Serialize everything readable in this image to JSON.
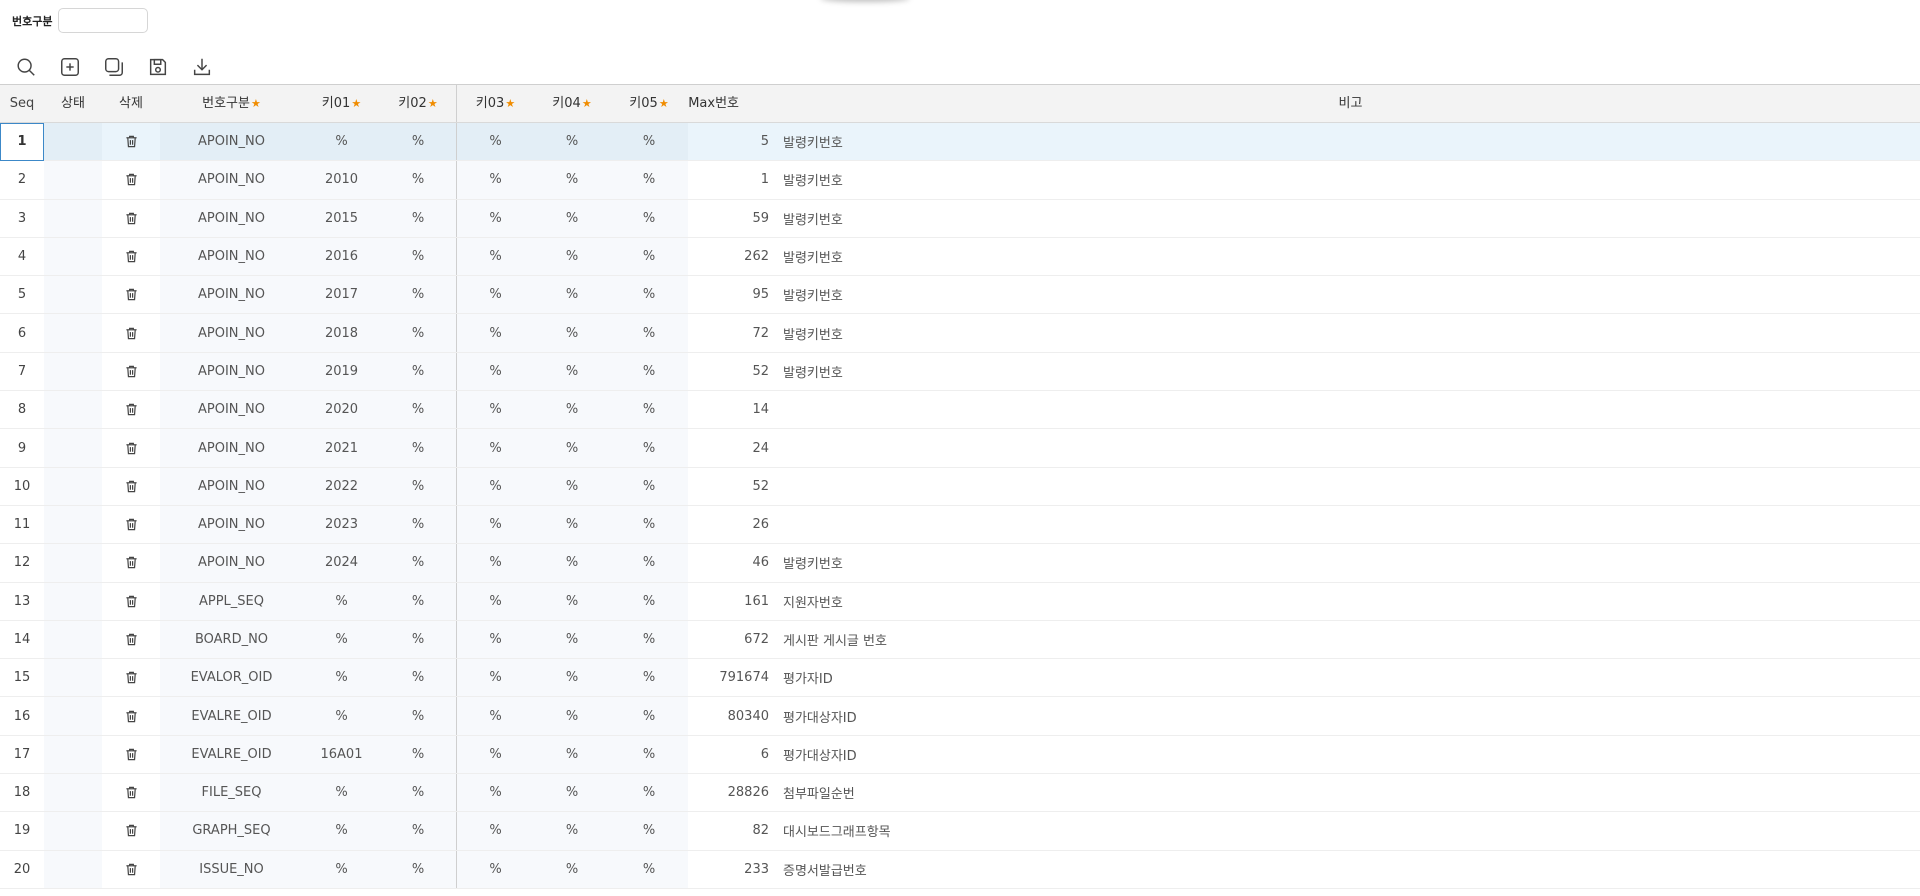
{
  "filter": {
    "label": "번호구분",
    "value": ""
  },
  "toolbar": {
    "buttons": [
      {
        "icon": "search-icon"
      },
      {
        "icon": "add-icon"
      },
      {
        "icon": "copy-icon"
      },
      {
        "icon": "save-icon"
      },
      {
        "icon": "download-icon"
      }
    ]
  },
  "columns": {
    "seq": "Seq",
    "state": "상태",
    "delete": "삭제",
    "number_type": "번호구분",
    "key01": "키01",
    "key02": "키02",
    "key03": "키03",
    "key04": "키04",
    "key05": "키05",
    "max_number": "Max번호",
    "note": "비고",
    "required_marker": "★",
    "required_marker_color": "#f08c00"
  },
  "rows": [
    {
      "seq": "1",
      "number_type": "APOIN_NO",
      "key01": "%",
      "key02": "%",
      "key03": "%",
      "key04": "%",
      "key05": "%",
      "max_number": "5",
      "note": "발령키번호"
    },
    {
      "seq": "2",
      "number_type": "APOIN_NO",
      "key01": "2010",
      "key02": "%",
      "key03": "%",
      "key04": "%",
      "key05": "%",
      "max_number": "1",
      "note": "발령키번호"
    },
    {
      "seq": "3",
      "number_type": "APOIN_NO",
      "key01": "2015",
      "key02": "%",
      "key03": "%",
      "key04": "%",
      "key05": "%",
      "max_number": "59",
      "note": "발령키번호"
    },
    {
      "seq": "4",
      "number_type": "APOIN_NO",
      "key01": "2016",
      "key02": "%",
      "key03": "%",
      "key04": "%",
      "key05": "%",
      "max_number": "262",
      "note": "발령키번호"
    },
    {
      "seq": "5",
      "number_type": "APOIN_NO",
      "key01": "2017",
      "key02": "%",
      "key03": "%",
      "key04": "%",
      "key05": "%",
      "max_number": "95",
      "note": "발령키번호"
    },
    {
      "seq": "6",
      "number_type": "APOIN_NO",
      "key01": "2018",
      "key02": "%",
      "key03": "%",
      "key04": "%",
      "key05": "%",
      "max_number": "72",
      "note": "발령키번호"
    },
    {
      "seq": "7",
      "number_type": "APOIN_NO",
      "key01": "2019",
      "key02": "%",
      "key03": "%",
      "key04": "%",
      "key05": "%",
      "max_number": "52",
      "note": "발령키번호"
    },
    {
      "seq": "8",
      "number_type": "APOIN_NO",
      "key01": "2020",
      "key02": "%",
      "key03": "%",
      "key04": "%",
      "key05": "%",
      "max_number": "14",
      "note": ""
    },
    {
      "seq": "9",
      "number_type": "APOIN_NO",
      "key01": "2021",
      "key02": "%",
      "key03": "%",
      "key04": "%",
      "key05": "%",
      "max_number": "24",
      "note": ""
    },
    {
      "seq": "10",
      "number_type": "APOIN_NO",
      "key01": "2022",
      "key02": "%",
      "key03": "%",
      "key04": "%",
      "key05": "%",
      "max_number": "52",
      "note": ""
    },
    {
      "seq": "11",
      "number_type": "APOIN_NO",
      "key01": "2023",
      "key02": "%",
      "key03": "%",
      "key04": "%",
      "key05": "%",
      "max_number": "26",
      "note": ""
    },
    {
      "seq": "12",
      "number_type": "APOIN_NO",
      "key01": "2024",
      "key02": "%",
      "key03": "%",
      "key04": "%",
      "key05": "%",
      "max_number": "46",
      "note": "발령키번호"
    },
    {
      "seq": "13",
      "number_type": "APPL_SEQ",
      "key01": "%",
      "key02": "%",
      "key03": "%",
      "key04": "%",
      "key05": "%",
      "max_number": "161",
      "note": "지원자번호"
    },
    {
      "seq": "14",
      "number_type": "BOARD_NO",
      "key01": "%",
      "key02": "%",
      "key03": "%",
      "key04": "%",
      "key05": "%",
      "max_number": "672",
      "note": "게시판 게시글 번호"
    },
    {
      "seq": "15",
      "number_type": "EVALOR_OID",
      "key01": "%",
      "key02": "%",
      "key03": "%",
      "key04": "%",
      "key05": "%",
      "max_number": "791674",
      "note": "평가자ID"
    },
    {
      "seq": "16",
      "number_type": "EVALRE_OID",
      "key01": "%",
      "key02": "%",
      "key03": "%",
      "key04": "%",
      "key05": "%",
      "max_number": "80340",
      "note": "평가대상자ID"
    },
    {
      "seq": "17",
      "number_type": "EVALRE_OID",
      "key01": "16A01",
      "key02": "%",
      "key03": "%",
      "key04": "%",
      "key05": "%",
      "max_number": "6",
      "note": "평가대상자ID"
    },
    {
      "seq": "18",
      "number_type": "FILE_SEQ",
      "key01": "%",
      "key02": "%",
      "key03": "%",
      "key04": "%",
      "key05": "%",
      "max_number": "28826",
      "note": "첨부파일순번"
    },
    {
      "seq": "19",
      "number_type": "GRAPH_SEQ",
      "key01": "%",
      "key02": "%",
      "key03": "%",
      "key04": "%",
      "key05": "%",
      "max_number": "82",
      "note": "대시보드그래프항목"
    },
    {
      "seq": "20",
      "number_type": "ISSUE_NO",
      "key01": "%",
      "key02": "%",
      "key03": "%",
      "key04": "%",
      "key05": "%",
      "max_number": "233",
      "note": "증명서발급번호"
    }
  ],
  "selected_row": "1"
}
